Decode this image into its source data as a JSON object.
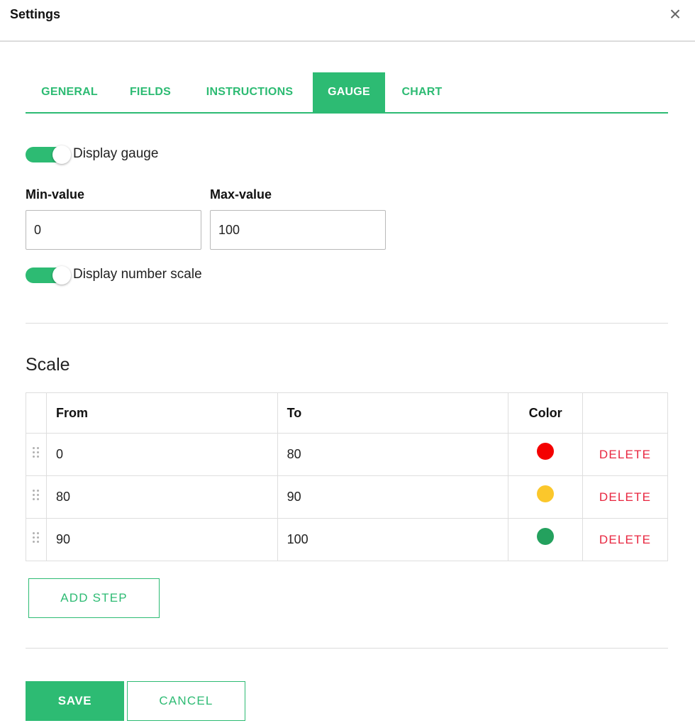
{
  "dialog": {
    "title": "Settings",
    "close_icon": "close-icon"
  },
  "tabs": [
    {
      "label": "GENERAL",
      "active": false
    },
    {
      "label": "FIELDS",
      "active": false
    },
    {
      "label": "INSTRUCTIONS",
      "active": false
    },
    {
      "label": "GAUGE",
      "active": true
    },
    {
      "label": "CHART",
      "active": false
    }
  ],
  "gauge": {
    "display_gauge": {
      "label": "Display gauge",
      "on": true
    },
    "min_value": {
      "label": "Min-value",
      "value": "0"
    },
    "max_value": {
      "label": "Max-value",
      "value": "100"
    },
    "display_number_scale": {
      "label": "Display number scale",
      "on": true
    }
  },
  "scale": {
    "title": "Scale",
    "columns": {
      "from": "From",
      "to": "To",
      "color": "Color"
    },
    "rows": [
      {
        "from": "0",
        "to": "80",
        "color": "#f40000",
        "action": "DELETE"
      },
      {
        "from": "80",
        "to": "90",
        "color": "#fbc72b",
        "action": "DELETE"
      },
      {
        "from": "90",
        "to": "100",
        "color": "#24a15e",
        "action": "DELETE"
      }
    ],
    "add_step_label": "ADD STEP"
  },
  "footer": {
    "save_label": "SAVE",
    "cancel_label": "CANCEL"
  },
  "colors": {
    "accent": "#2dbb73",
    "danger": "#e8263f"
  }
}
